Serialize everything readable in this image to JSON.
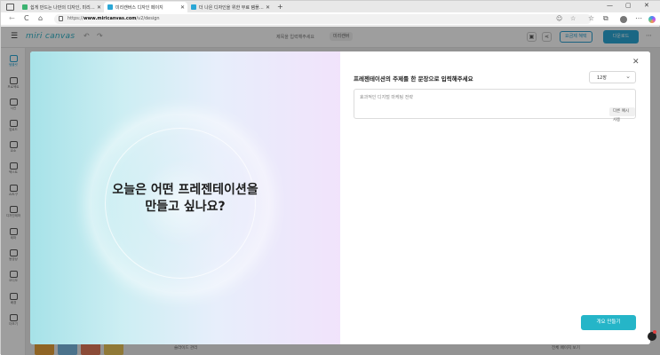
{
  "browser": {
    "tabs": [
      {
        "title": "쉽게 만드는 나만의 디자인, 미리…",
        "favicon_color": "#3cb371",
        "active": false
      },
      {
        "title": "미리캔버스 디자인 페이지",
        "favicon_color": "#2aa7d6",
        "active": true
      },
      {
        "title": "더 나은 디자인을 위한 무료 템플…",
        "favicon_color": "#2aa7d6",
        "active": false
      }
    ],
    "new_tab": "+",
    "window_controls": {
      "minimize": "—",
      "maximize": "▢",
      "close": "✕"
    },
    "nav": {
      "back": "←",
      "reload": "C",
      "home": "⌂"
    },
    "url_prefix": "https://",
    "url_host": "www.miricanvas.com",
    "url_path": "/v2/design"
  },
  "app": {
    "logo": "miri canvas",
    "doc_title": "제목을 입력해주세요",
    "share_chip": "미리캔버",
    "price_button": "요금제 혜택",
    "download_button": "다운로드",
    "sidebar": [
      {
        "label": "템플릿",
        "active": true
      },
      {
        "label": "프로젝트",
        "active": false
      },
      {
        "label": "사진",
        "active": false
      },
      {
        "label": "업로드",
        "active": false
      },
      {
        "label": "요소",
        "active": false
      },
      {
        "label": "텍스트",
        "active": false
      },
      {
        "label": "AI도구",
        "active": false
      },
      {
        "label": "디자인테마",
        "active": false
      },
      {
        "label": "테마",
        "active": false
      },
      {
        "label": "동영상",
        "active": false
      },
      {
        "label": "오디오",
        "active": false
      },
      {
        "label": "배경",
        "active": false
      },
      {
        "label": "더보기",
        "active": false
      }
    ],
    "bottom_left_text": "슬라이드 관리",
    "bottom_right_text": "전체 페이지 보기",
    "bottom_thumb_colors": [
      "#e7a23a",
      "#7ab8e0",
      "#e07a5a",
      "#e8c35a"
    ]
  },
  "modal": {
    "headline": "오늘은 어떤 프레젠테이션을\n만들고 싶나요?",
    "headline_line1": "오늘은 어떤 프레젠테이션을",
    "headline_line2": "만들고 싶나요?",
    "prompt_label": "프레젠테이션의 주제를 한 문장으로 입력해주세요",
    "page_count": "12장",
    "textarea_placeholder": "효과적인 디지털 마케팅 전략",
    "example_button": "다른 예시 사용",
    "generate_button": "개요 만들기",
    "close_icon": "✕",
    "accent_color": "#25b5c8"
  }
}
